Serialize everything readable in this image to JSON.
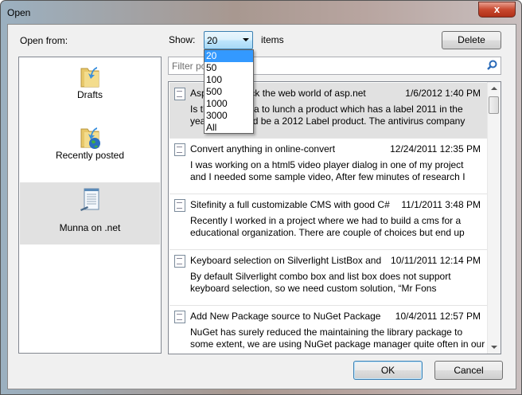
{
  "window": {
    "title": "Open",
    "close": "x"
  },
  "open_from_label": "Open from:",
  "sources": [
    {
      "label": "Drafts"
    },
    {
      "label": "Recently posted"
    },
    {
      "label": "Munna on .net",
      "selected": true
    }
  ],
  "show": {
    "label": "Show:",
    "value": "20",
    "suffix": "items",
    "options": [
      "20",
      "50",
      "100",
      "500",
      "1000",
      "3000",
      "All"
    ]
  },
  "delete_label": "Delete",
  "filter": {
    "placeholder": "Filter po"
  },
  "posts": [
    {
      "title_a": "Asp",
      "title_b": "rock the web world of asp.net",
      "date": "1/6/2012 1:40 PM",
      "l1a": "Is th",
      "l1b": "dea to lunch a product which has a label 2011 in the",
      "l2a": "yea",
      "l2b": "uld be a 2012 Label product. The antivirus company"
    },
    {
      "title": "Convert anything in online-convert",
      "date": "12/24/2011 12:35 PM",
      "l1": "I was working on a html5 video player dialog in one of my project",
      "l2": "and I needed some sample video, After few minutes of research I"
    },
    {
      "title": "Sitefinity a full customizable CMS with good C#",
      "date": "11/1/2011 3:48 PM",
      "l1": "Recently I worked in a project where we had to build a cms for a",
      "l2": "educational organization. There are couple of choices but end up"
    },
    {
      "title": "Keyboard selection on Silverlight ListBox and",
      "date": "10/11/2011 12:14 PM",
      "l1": "By default Silverlight combo box and list box does not support",
      "l2": "keyboard selection, so we need custom solution, “Mr Fons"
    },
    {
      "title": "Add New Package source to NuGet Package",
      "date": "10/4/2011 12:57 PM",
      "l1": "NuGet has surely reduced the maintaining the library package to",
      "l2": "some extent, we are using NuGet package manager quite often in our"
    }
  ],
  "ok_label": "OK",
  "cancel_label": "Cancel"
}
